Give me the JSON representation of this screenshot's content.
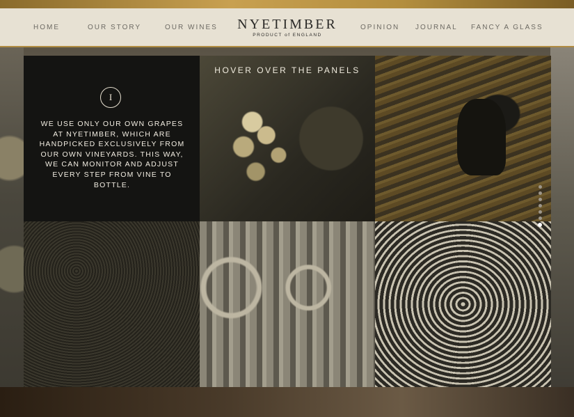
{
  "nav": {
    "home": "HOME",
    "our_story": "OUR STORY",
    "our_wines": "OUR WINES",
    "opinion": "OPINION",
    "journal": "JOURNAL",
    "fancy_a_glass": "FANCY A GLASS"
  },
  "logo": {
    "name": "NYETIMBER",
    "tagline": "PRODUCT of ENGLAND"
  },
  "panels": {
    "hint": "HOVER OVER THE PANELS",
    "numeral": "I",
    "description": "WE USE ONLY OUR OWN GRAPES AT NYETIMBER, WHICH ARE HANDPICKED EXCLUSIVELY FROM OUR OWN VINEYARDS. THIS WAY, WE CAN MONITOR AND ADJUST EVERY STEP FROM VINE TO BOTTLE."
  },
  "pager": {
    "count": 7,
    "active_index": 6
  },
  "colors": {
    "header_bg": "#e7e1d3",
    "gold_accent": "#b08c42",
    "nav_text": "#6d6a63"
  }
}
